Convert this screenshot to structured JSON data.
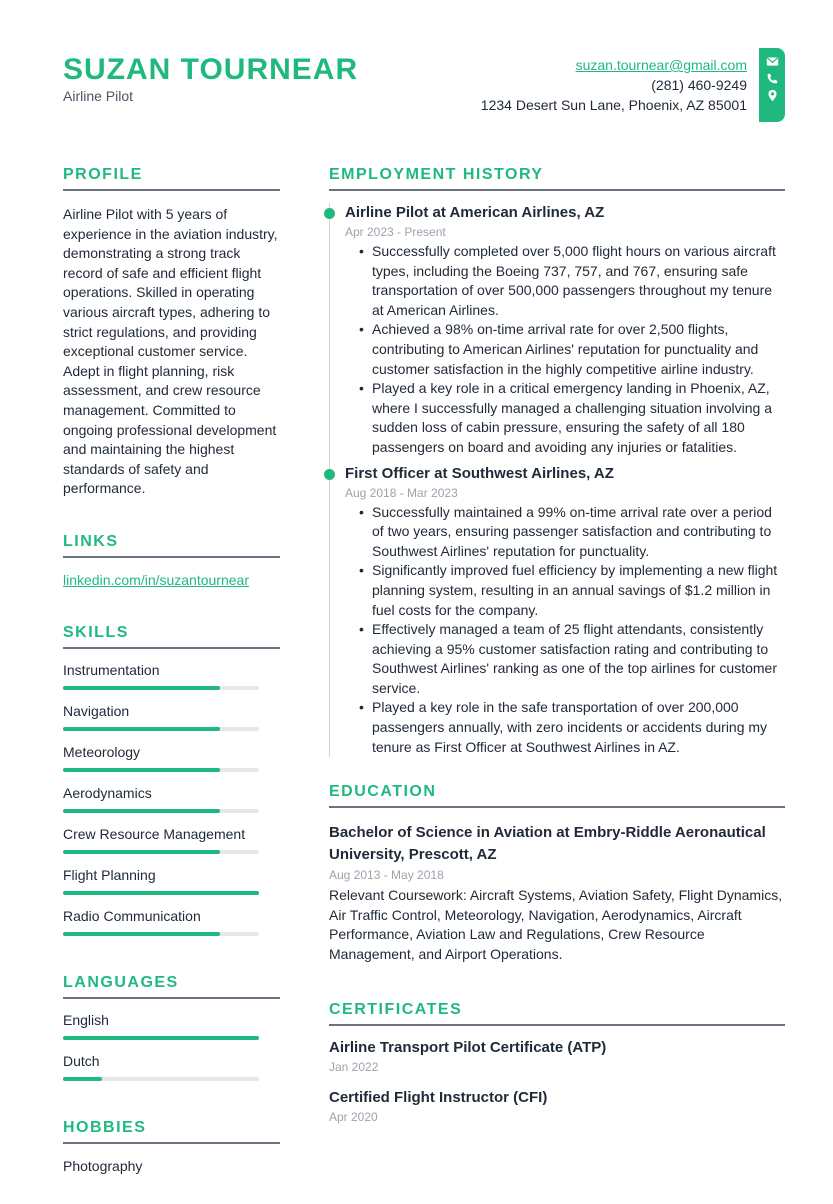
{
  "header": {
    "name": "SUZAN TOURNEAR",
    "title": "Airline Pilot",
    "email": "suzan.tournear@gmail.com",
    "phone": "(281) 460-9249",
    "address": "1234 Desert Sun Lane, Phoenix, AZ 85001",
    "icons": [
      "envelope-icon",
      "phone-icon",
      "location-pin-icon"
    ]
  },
  "colors": {
    "accent": "#1fb97f",
    "text": "#1f2937",
    "muted": "#9ca3af",
    "track": "#e5e7eb"
  },
  "profile": {
    "heading": "PROFILE",
    "text": "Airline Pilot with 5 years of experience in the aviation industry, demonstrating a strong track record of safe and efficient flight operations. Skilled in operating various aircraft types, adhering to strict regulations, and providing exceptional customer service. Adept in flight planning, risk assessment, and crew resource management. Committed to ongoing professional development and maintaining the highest standards of safety and performance."
  },
  "links": {
    "heading": "LINKS",
    "items": [
      {
        "label": "linkedin.com/in/suzantournear"
      }
    ]
  },
  "skills": {
    "heading": "SKILLS",
    "items": [
      {
        "label": "Instrumentation",
        "level": 0.8
      },
      {
        "label": "Navigation",
        "level": 0.8
      },
      {
        "label": "Meteorology",
        "level": 0.8
      },
      {
        "label": "Aerodynamics",
        "level": 0.8
      },
      {
        "label": "Crew Resource Management",
        "level": 0.8
      },
      {
        "label": "Flight Planning",
        "level": 1.0
      },
      {
        "label": "Radio Communication",
        "level": 0.8
      }
    ]
  },
  "languages": {
    "heading": "LANGUAGES",
    "items": [
      {
        "label": "English",
        "level": 1.0
      },
      {
        "label": "Dutch",
        "level": 0.2
      }
    ]
  },
  "hobbies": {
    "heading": "HOBBIES",
    "items": [
      {
        "label": "Photography"
      }
    ]
  },
  "employment": {
    "heading": "EMPLOYMENT HISTORY",
    "jobs": [
      {
        "title": "Airline Pilot at American Airlines, AZ",
        "date": "Apr 2023 - Present",
        "bullets": [
          "Successfully completed over 5,000 flight hours on various aircraft types, including the Boeing 737, 757, and 767, ensuring safe transportation of over 500,000 passengers throughout my tenure at American Airlines.",
          "Achieved a 98% on-time arrival rate for over 2,500 flights, contributing to American Airlines' reputation for punctuality and customer satisfaction in the highly competitive airline industry.",
          "Played a key role in a critical emergency landing in Phoenix, AZ, where I successfully managed a challenging situation involving a sudden loss of cabin pressure, ensuring the safety of all 180 passengers on board and avoiding any injuries or fatalities."
        ]
      },
      {
        "title": "First Officer at Southwest Airlines, AZ",
        "date": "Aug 2018 - Mar 2023",
        "bullets": [
          "Successfully maintained a 99% on-time arrival rate over a period of two years, ensuring passenger satisfaction and contributing to Southwest Airlines' reputation for punctuality.",
          "Significantly improved fuel efficiency by implementing a new flight planning system, resulting in an annual savings of $1.2 million in fuel costs for the company.",
          "Effectively managed a team of 25 flight attendants, consistently achieving a 95% customer satisfaction rating and contributing to Southwest Airlines' ranking as one of the top airlines for customer service.",
          "Played a key role in the safe transportation of over 200,000 passengers annually, with zero incidents or accidents during my tenure as First Officer at Southwest Airlines in AZ."
        ]
      }
    ]
  },
  "education": {
    "heading": "EDUCATION",
    "items": [
      {
        "title": "Bachelor of Science in Aviation at Embry-Riddle Aeronautical University, Prescott, AZ",
        "date": "Aug 2013 - May 2018",
        "description": "Relevant Coursework: Aircraft Systems, Aviation Safety, Flight Dynamics, Air Traffic Control, Meteorology, Navigation, Aerodynamics, Aircraft Performance, Aviation Law and Regulations, Crew Resource Management, and Airport Operations."
      }
    ]
  },
  "certificates": {
    "heading": "CERTIFICATES",
    "items": [
      {
        "name": "Airline Transport Pilot Certificate (ATP)",
        "date": "Jan 2022"
      },
      {
        "name": "Certified Flight Instructor (CFI)",
        "date": "Apr 2020"
      }
    ]
  }
}
